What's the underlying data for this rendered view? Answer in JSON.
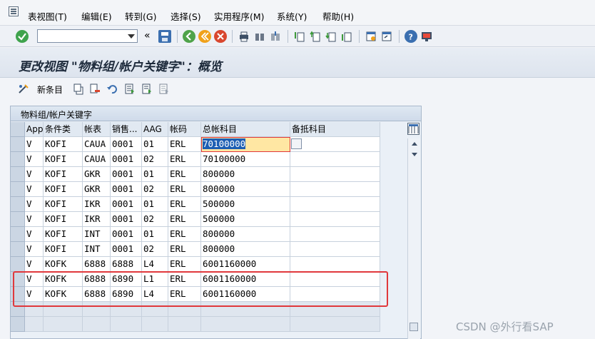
{
  "menu": {
    "items": [
      "表视图(T)",
      "编辑(E)",
      "转到(G)",
      "选择(S)",
      "实用程序(M)",
      "系统(Y)",
      "帮助(H)"
    ]
  },
  "toolbar": {
    "command_field_value": "",
    "back_glyph": "«"
  },
  "title": "更改视图 \"物料组/帐户关键字\"：概览",
  "app_toolbar": {
    "new_entries_label": "新条目"
  },
  "table": {
    "panel_title": "物料组/帐户关键字",
    "columns": [
      "App",
      "条件类",
      "帐表",
      "销售...",
      "AAG",
      "帐码",
      "总帐科目",
      "备抵科目"
    ],
    "rows": [
      [
        "V",
        "KOFI",
        "CAUA",
        "0001",
        "01",
        "ERL",
        "70100000",
        ""
      ],
      [
        "V",
        "KOFI",
        "CAUA",
        "0001",
        "02",
        "ERL",
        "70100000",
        ""
      ],
      [
        "V",
        "KOFI",
        "GKR",
        "0001",
        "01",
        "ERL",
        "800000",
        ""
      ],
      [
        "V",
        "KOFI",
        "GKR",
        "0001",
        "02",
        "ERL",
        "800000",
        ""
      ],
      [
        "V",
        "KOFI",
        "IKR",
        "0001",
        "01",
        "ERL",
        "500000",
        ""
      ],
      [
        "V",
        "KOFI",
        "IKR",
        "0001",
        "02",
        "ERL",
        "500000",
        ""
      ],
      [
        "V",
        "KOFI",
        "INT",
        "0001",
        "01",
        "ERL",
        "800000",
        ""
      ],
      [
        "V",
        "KOFI",
        "INT",
        "0001",
        "02",
        "ERL",
        "800000",
        ""
      ],
      [
        "V",
        "KOFK",
        "6888",
        "6888",
        "L4",
        "ERL",
        "6001160000",
        ""
      ],
      [
        "V",
        "KOFK",
        "6888",
        "6890",
        "L1",
        "ERL",
        "6001160000",
        ""
      ],
      [
        "V",
        "KOFK",
        "6888",
        "6890",
        "L4",
        "ERL",
        "6001160000",
        ""
      ]
    ]
  },
  "watermark": "CSDN @外行看SAP",
  "colors": {
    "highlight": "#e0383c",
    "selected_cell": "#ffe7a3"
  }
}
